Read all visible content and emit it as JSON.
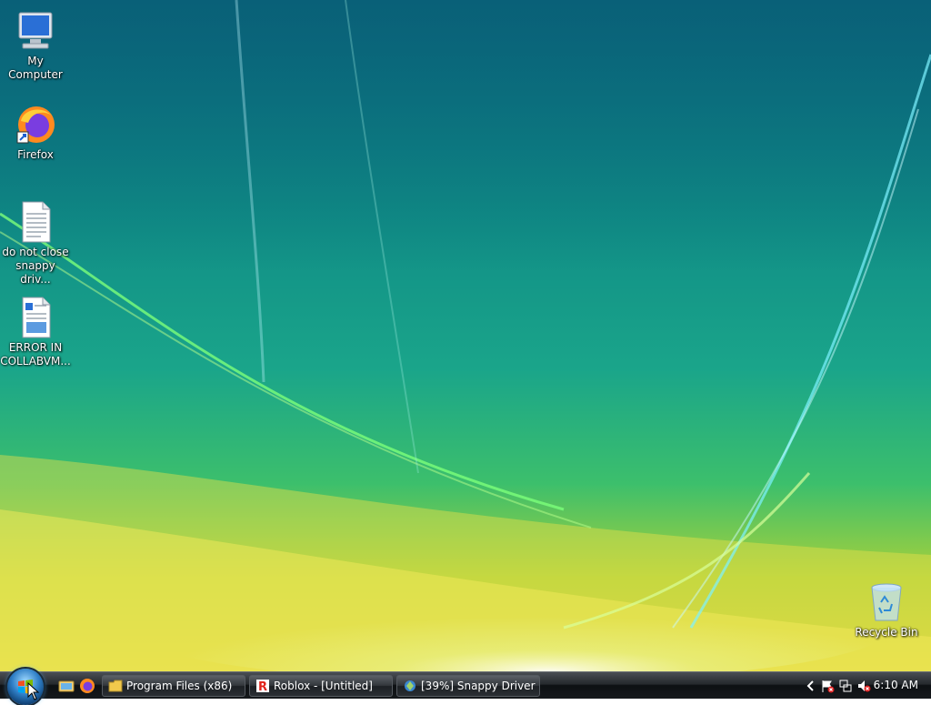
{
  "desktop": {
    "icons": [
      {
        "label": "My Computer",
        "icon": "computer-icon"
      },
      {
        "label": "Firefox",
        "icon": "firefox-icon"
      },
      {
        "label": "do not close\nsnappy driv...",
        "icon": "text-file-icon"
      },
      {
        "label": "ERROR IN\nCOLLABVM...",
        "icon": "document-icon"
      },
      {
        "label": "Recycle Bin",
        "icon": "recycle-bin-icon"
      }
    ]
  },
  "taskbar": {
    "quick_launch": [
      "show-desktop-icon",
      "firefox-icon"
    ],
    "tasks": [
      {
        "label": "Program Files (x86)",
        "icon": "folder-icon"
      },
      {
        "label": "Roblox - [Untitled]",
        "icon": "roblox-icon"
      },
      {
        "label": "[39%] Snappy Driver I...",
        "icon": "snappy-driver-icon"
      }
    ],
    "tray": {
      "icons": [
        "show-hidden-icons-chevron",
        "action-center-flag-icon",
        "network-icon",
        "volume-muted-icon"
      ],
      "clock": "6:10 AM"
    }
  },
  "colors": {
    "taskbar": "#1a1d21",
    "accent": "#2f7fc7"
  }
}
